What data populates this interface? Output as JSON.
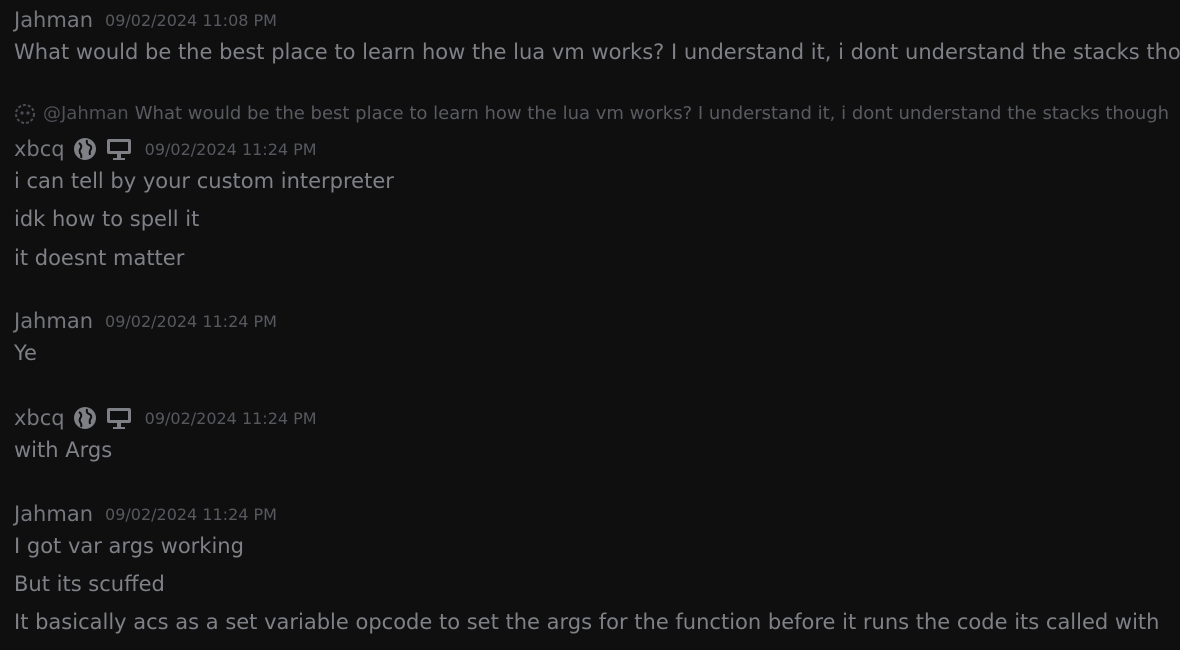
{
  "chat": {
    "messages": [
      {
        "author": "Jahman",
        "timestamp": "09/02/2024 11:08 PM",
        "lines": [
          "What would be the best place to learn how the lua vm works? I understand it, i dont understand the stacks though"
        ]
      },
      {
        "reply": {
          "mention": "@Jahman",
          "text": "What would be the best place to learn how the lua vm works? I understand it, i dont understand the stacks though"
        },
        "author": "xbcq",
        "badges": [
          "globe-icon",
          "monitor-icon"
        ],
        "timestamp": "09/02/2024 11:24 PM",
        "lines": [
          "i can tell by your custom interpreter",
          "idk how to spell it",
          "it doesnt matter"
        ]
      },
      {
        "author": "Jahman",
        "timestamp": "09/02/2024 11:24 PM",
        "lines": [
          "Ye"
        ]
      },
      {
        "author": "xbcq",
        "badges": [
          "globe-icon",
          "monitor-icon"
        ],
        "timestamp": "09/02/2024 11:24 PM",
        "lines": [
          "with Args"
        ]
      },
      {
        "author": "Jahman",
        "timestamp": "09/02/2024 11:24 PM",
        "lines": [
          "I got var args working",
          "But its scuffed",
          "It basically acs as a set variable opcode to set the args for the function before it runs the code its called with"
        ]
      }
    ]
  },
  "colors": {
    "background": "#0f0f10",
    "username": "#76787d",
    "timestamp": "#57595e",
    "text": "#7f8186",
    "reply_text": "#595b60",
    "icon": "#7e8085"
  }
}
